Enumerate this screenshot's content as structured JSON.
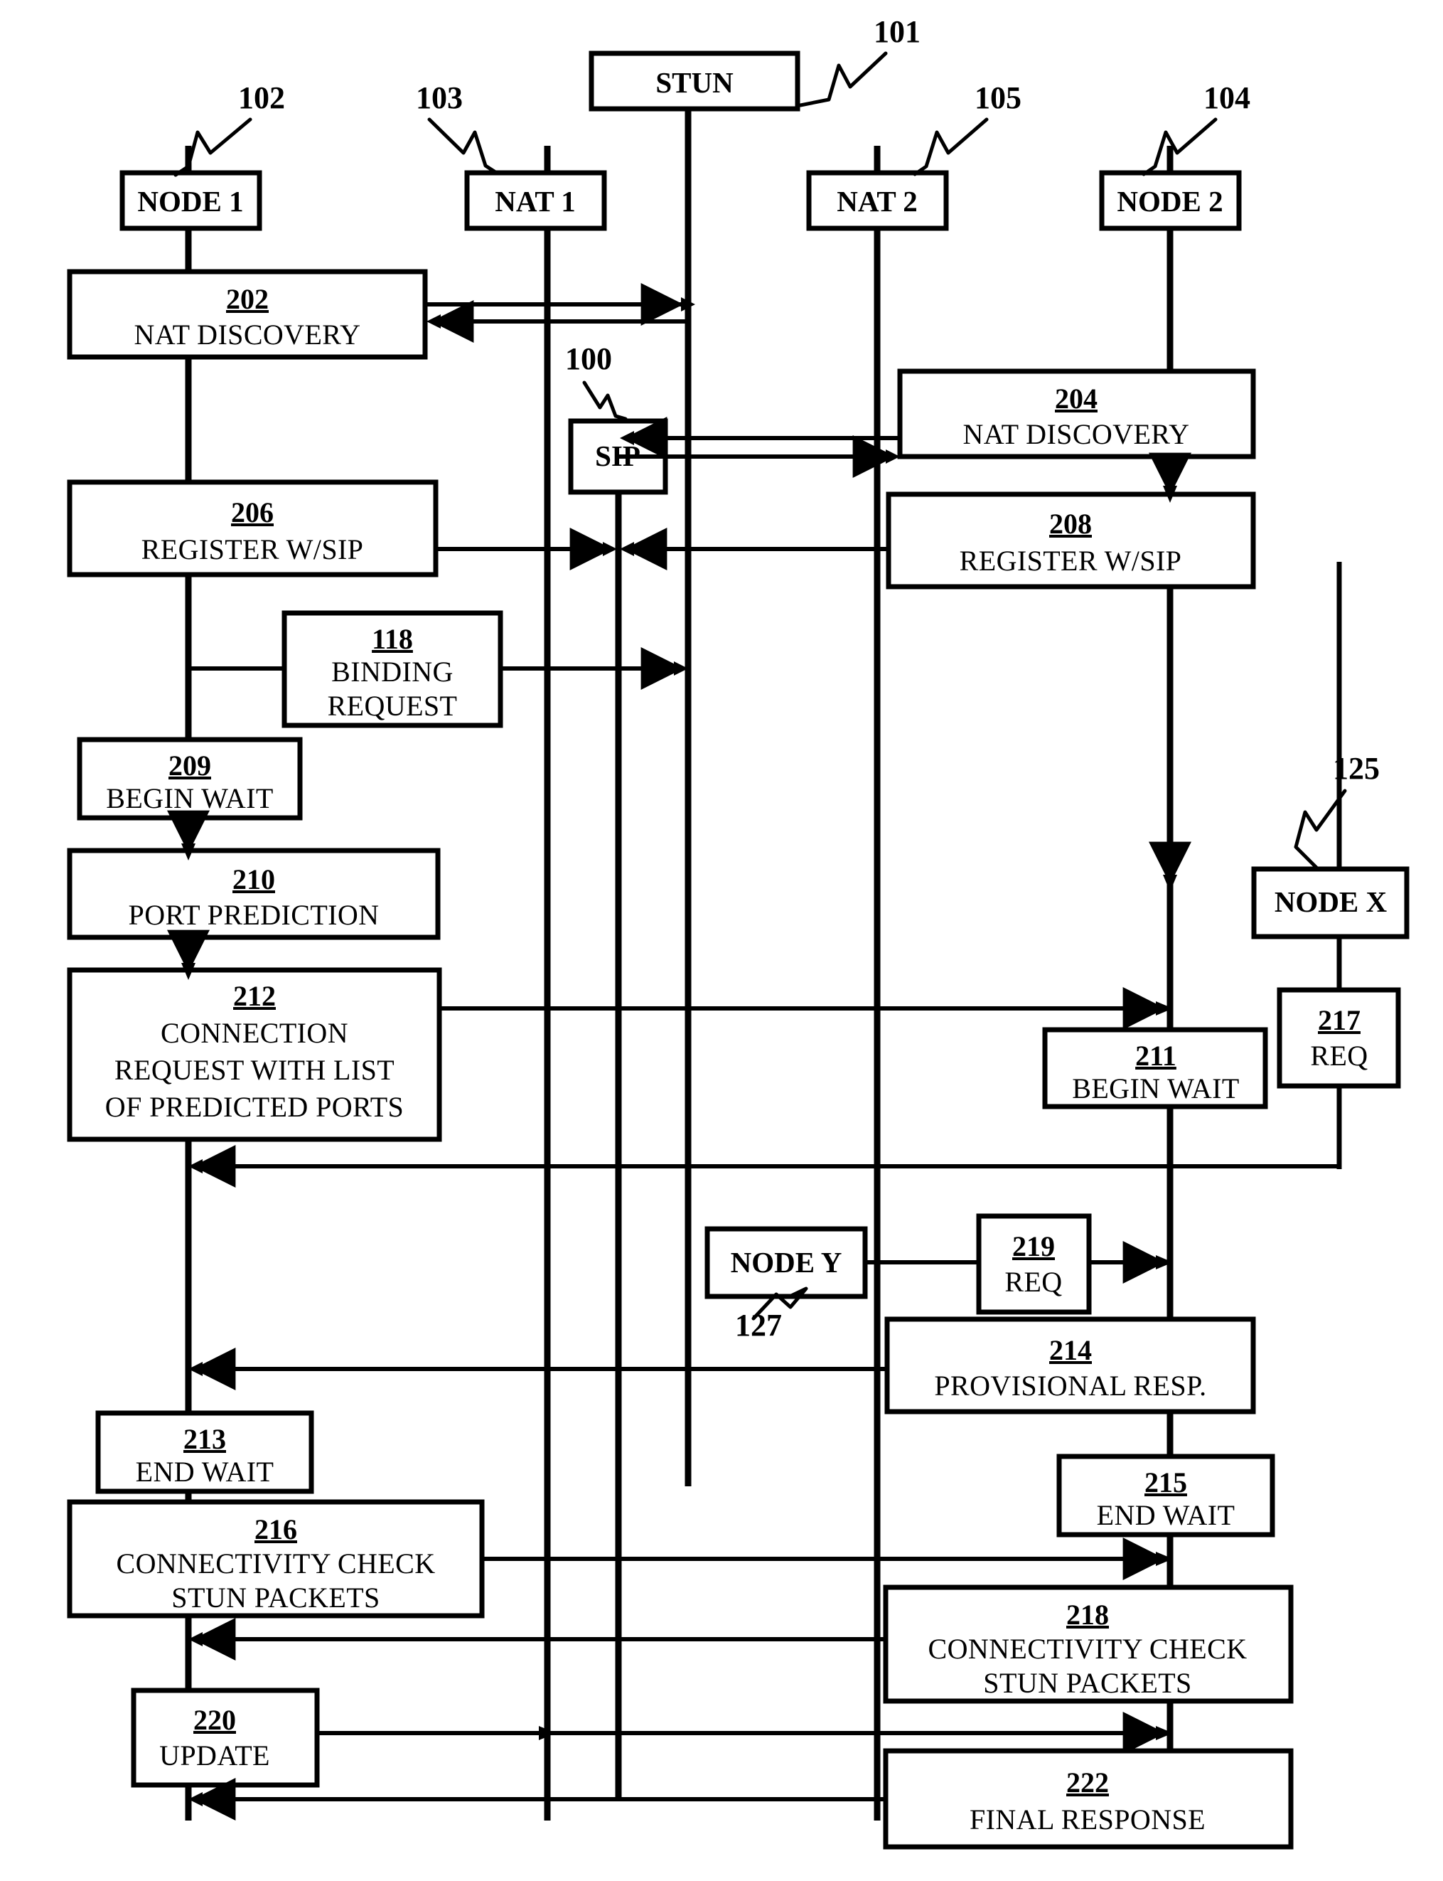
{
  "figure": {
    "type": "patent-sequence-diagram",
    "background": "#ffffff",
    "ink": "#000000"
  },
  "actors": [
    {
      "id": "node1",
      "label": "NODE 1",
      "ref": "102"
    },
    {
      "id": "nat1",
      "label": "NAT 1",
      "ref": "103"
    },
    {
      "id": "stun",
      "label": "STUN",
      "ref": "101"
    },
    {
      "id": "sip",
      "label": "SIP",
      "ref": "100"
    },
    {
      "id": "nat2",
      "label": "NAT 2",
      "ref": "105"
    },
    {
      "id": "node2",
      "label": "NODE 2",
      "ref": "104"
    },
    {
      "id": "nodex",
      "label": "NODE X",
      "ref": "125"
    },
    {
      "id": "nodey",
      "label": "NODE Y",
      "ref": "127"
    }
  ],
  "steps": [
    {
      "num": "202",
      "lines": [
        "NAT DISCOVERY"
      ],
      "lane": "node1"
    },
    {
      "num": "204",
      "lines": [
        "NAT DISCOVERY"
      ],
      "lane": "node2"
    },
    {
      "num": "206",
      "lines": [
        "REGISTER W/SIP"
      ],
      "lane": "node1"
    },
    {
      "num": "208",
      "lines": [
        "REGISTER W/SIP"
      ],
      "lane": "node2"
    },
    {
      "num": "118",
      "lines": [
        "BINDING",
        "REQUEST"
      ],
      "lane": "node1"
    },
    {
      "num": "209",
      "lines": [
        "BEGIN WAIT"
      ],
      "lane": "node1"
    },
    {
      "num": "210",
      "lines": [
        "PORT PREDICTION"
      ],
      "lane": "node1"
    },
    {
      "num": "212",
      "lines": [
        "CONNECTION",
        "REQUEST WITH LIST",
        "OF PREDICTED PORTS"
      ],
      "lane": "node1"
    },
    {
      "num": "211",
      "lines": [
        "BEGIN WAIT"
      ],
      "lane": "node2"
    },
    {
      "num": "217",
      "lines": [
        "REQ"
      ],
      "lane": "nodex"
    },
    {
      "num": "219",
      "lines": [
        "REQ"
      ],
      "lane": "nodey"
    },
    {
      "num": "214",
      "lines": [
        "PROVISIONAL RESP."
      ],
      "lane": "node2"
    },
    {
      "num": "213",
      "lines": [
        "END WAIT"
      ],
      "lane": "node1"
    },
    {
      "num": "215",
      "lines": [
        "END WAIT"
      ],
      "lane": "node2"
    },
    {
      "num": "216",
      "lines": [
        "CONNECTIVITY CHECK",
        "STUN PACKETS"
      ],
      "lane": "node1"
    },
    {
      "num": "218",
      "lines": [
        "CONNECTIVITY CHECK",
        "STUN PACKETS"
      ],
      "lane": "node2"
    },
    {
      "num": "220",
      "lines": [
        "UPDATE"
      ],
      "lane": "node1"
    },
    {
      "num": "222",
      "lines": [
        "FINAL RESPONSE"
      ],
      "lane": "node2"
    }
  ],
  "labels": {
    "node1": "NODE 1",
    "nat1": "NAT 1",
    "stun": "STUN",
    "sip": "SIP",
    "nat2": "NAT 2",
    "node2": "NODE 2",
    "nodex": "NODE X",
    "nodey": "NODE Y",
    "ref_100": "100",
    "ref_101": "101",
    "ref_102": "102",
    "ref_103": "103",
    "ref_104": "104",
    "ref_105": "105",
    "ref_125": "125",
    "ref_127": "127",
    "n202": "202",
    "n204": "204",
    "n206": "206",
    "n208": "208",
    "n118": "118",
    "n209": "209",
    "n210": "210",
    "n211": "211",
    "n212": "212",
    "n213": "213",
    "n214": "214",
    "n215": "215",
    "n216": "216",
    "n217": "217",
    "n218": "218",
    "n219": "219",
    "n220": "220",
    "n222": "222",
    "t_nat_discovery": "NAT DISCOVERY",
    "t_register_wsip": "REGISTER W/SIP",
    "t_binding": "BINDING",
    "t_request": "REQUEST",
    "t_begin_wait": "BEGIN WAIT",
    "t_port_prediction": "PORT PREDICTION",
    "t_connection": "CONNECTION",
    "t_request_with_list": "REQUEST WITH LIST",
    "t_of_predicted_ports": "OF PREDICTED PORTS",
    "t_req": "REQ",
    "t_provisional_resp": "PROVISIONAL RESP.",
    "t_end_wait": "END WAIT",
    "t_connectivity_check": "CONNECTIVITY CHECK",
    "t_stun_packets": "STUN PACKETS",
    "t_update": "UPDATE",
    "t_final_response": "FINAL RESPONSE"
  }
}
